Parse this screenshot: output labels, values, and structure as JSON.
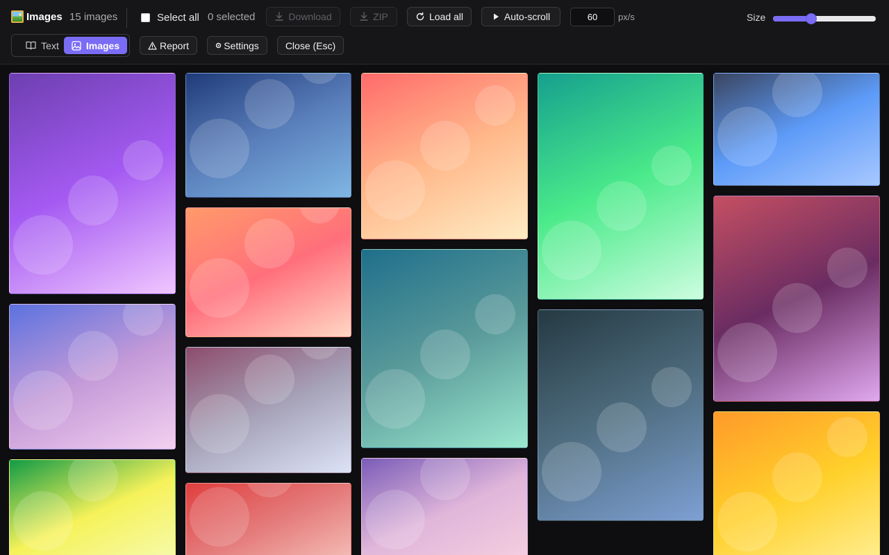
{
  "header": {
    "title": "Images",
    "count_label": "15 images",
    "select_all_label": "Select all",
    "selected_label": "0 selected",
    "download_label": "Download",
    "zip_label": "ZIP",
    "load_all_label": "Load all",
    "auto_scroll_label": "Auto-scroll",
    "speed_value": "60",
    "speed_unit": "px/s",
    "size_label": "Size",
    "size_value": 0.37
  },
  "tabs": [
    {
      "label": "Text",
      "active": false
    },
    {
      "label": "Images",
      "active": true
    }
  ],
  "actions": {
    "report_label": "Report",
    "settings_label": "Settings",
    "close_label": "Close (Esc)"
  },
  "colors": {
    "accent": "#7b6cf6",
    "toolbar_bg": "#161618",
    "page_bg": "#0e0e10"
  },
  "images": [
    {
      "column": 1,
      "gradient": [
        "#6d3fb0",
        "#a45af2",
        "#f0c6ff"
      ]
    },
    {
      "column": 1,
      "gradient": [
        "#5b72df",
        "#c49ad8",
        "#f3d0f0"
      ]
    },
    {
      "column": 1,
      "gradient": [
        "#129b45",
        "#f6f25a",
        "#f6fbb6"
      ]
    },
    {
      "column": 2,
      "gradient": [
        "#203b7a",
        "#5a7fbb",
        "#7fb6e4"
      ]
    },
    {
      "column": 2,
      "gradient": [
        "#ff9a6a",
        "#ff6f7b",
        "#ffd7c4"
      ]
    },
    {
      "column": 2,
      "gradient": [
        "#8d4c6c",
        "#a6a2b8",
        "#dce3f6"
      ]
    },
    {
      "column": 2,
      "gradient": [
        "#e03f3f",
        "#e47b7b",
        "#f6c2bb"
      ]
    },
    {
      "column": 3,
      "gradient": [
        "#ff6b6b",
        "#ffb88a",
        "#ffecc4"
      ]
    },
    {
      "column": 3,
      "gradient": [
        "#1f6f8b",
        "#5a9a9a",
        "#9be8cf"
      ]
    },
    {
      "column": 3,
      "gradient": [
        "#7a5cb8",
        "#e0b6da",
        "#f7d1e0"
      ]
    },
    {
      "column": 4,
      "gradient": [
        "#15a08e",
        "#4bea8a",
        "#cdfde0"
      ]
    },
    {
      "column": 4,
      "gradient": [
        "#253a42",
        "#4f6d80",
        "#7ea0d4"
      ]
    },
    {
      "column": 5,
      "gradient": [
        "#3a4560",
        "#5d9bf8",
        "#a8c8ff"
      ]
    },
    {
      "column": 5,
      "gradient": [
        "#c54f62",
        "#6a2c62",
        "#e0a8f0"
      ]
    },
    {
      "column": 5,
      "gradient": [
        "#ff9a2a",
        "#ffd02a",
        "#fff09a"
      ]
    }
  ]
}
